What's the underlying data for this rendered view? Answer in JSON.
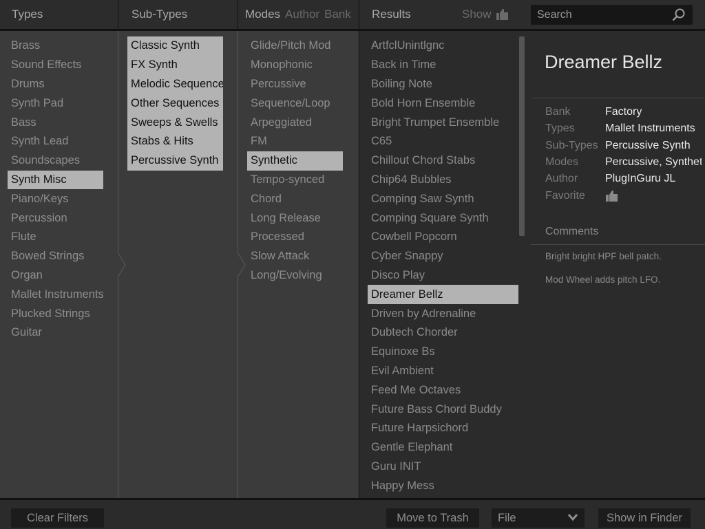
{
  "header": {
    "types": "Types",
    "subtypes": "Sub-Types",
    "modes_tabs": [
      {
        "label": "Modes",
        "active": true
      },
      {
        "label": "Author",
        "active": false
      },
      {
        "label": "Bank",
        "active": false
      }
    ],
    "results": "Results",
    "show": "Show",
    "show_icon": "thumbs-up-icon",
    "search_placeholder": "Search",
    "search_icon": "search-icon"
  },
  "types": {
    "items": [
      "Brass",
      "Sound Effects",
      "Drums",
      "Synth Pad",
      "Bass",
      "Synth Lead",
      "Soundscapes",
      "Synth Misc",
      "Piano/Keys",
      "Percussion",
      "Flute",
      "Bowed Strings",
      "Organ",
      "Mallet Instruments",
      "Plucked Strings",
      "Guitar"
    ],
    "selected": "Synth Misc"
  },
  "subtypes": {
    "items": [
      "Classic Synth",
      "FX Synth",
      "Melodic Sequences",
      "Other Sequences",
      "Sweeps & Swells",
      "Stabs & Hits",
      "Percussive Synth"
    ]
  },
  "modes": {
    "items": [
      "Glide/Pitch Mod",
      "Monophonic",
      "Percussive",
      "Sequence/Loop",
      "Arpeggiated",
      "FM",
      "Synthetic",
      "Tempo-synced",
      "Chord",
      "Long Release",
      "Processed",
      "Slow Attack",
      "Long/Evolving"
    ],
    "selected": "Synthetic"
  },
  "results": {
    "items": [
      "ArtfclUnintlgnc",
      "Back in Time",
      "Boiling Note",
      "Bold Horn Ensemble",
      "Bright Trumpet Ensemble",
      "C65",
      "Chillout Chord Stabs",
      "Chip64 Bubbles",
      "Comping Saw Synth",
      "Comping Square Synth",
      "Cowbell Popcorn",
      "Cyber Snappy",
      "Disco Play",
      "Dreamer Bellz",
      "Driven by Adrenaline",
      "Dubtech Chorder",
      "Equinoxe Bs",
      "Evil Ambient",
      "Feed Me Octaves",
      "Future Bass Chord Buddy",
      "Future Harpsichord",
      "Gentle Elephant",
      "Guru INIT",
      "Happy Mess"
    ],
    "selected": "Dreamer Bellz"
  },
  "detail": {
    "title": "Dreamer Bellz",
    "fields": [
      {
        "key": "Bank",
        "value": "Factory"
      },
      {
        "key": "Types",
        "value": "Mallet Instruments"
      },
      {
        "key": "Sub-Types",
        "value": "Percussive Synth"
      },
      {
        "key": "Modes",
        "value": "Percussive, Synthetic"
      },
      {
        "key": "Author",
        "value": "PlugInGuru JL"
      }
    ],
    "favorite_label": "Favorite",
    "favorite_icon": "thumbs-up-icon",
    "comments_label": "Comments",
    "comments": [
      "Bright bright HPF bell patch.",
      "Mod Wheel adds pitch LFO."
    ]
  },
  "footer": {
    "clear_filters": "Clear Filters",
    "move_to_trash": "Move to Trash",
    "file_select": "File",
    "show_in_finder": "Show in Finder"
  },
  "colors": {
    "selection": "#b3b3b3",
    "panel": "#3b3b3b",
    "dark_panel": "#2b2b2b",
    "search_bg": "#161616"
  }
}
